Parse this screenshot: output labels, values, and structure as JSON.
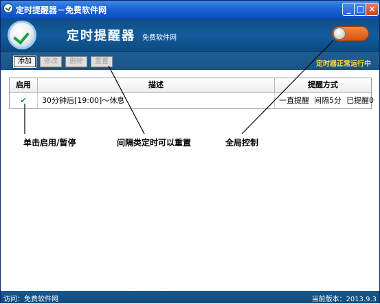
{
  "window": {
    "title": "定时提醒器－免费软件网"
  },
  "header": {
    "app_title": "定时提醒器",
    "subtitle": "免费软件网",
    "global_switch_on": true
  },
  "toolbar": {
    "buttons": [
      {
        "label": "添加",
        "enabled": true
      },
      {
        "label": "修改",
        "enabled": false
      },
      {
        "label": "删除",
        "enabled": false
      },
      {
        "label": "重置",
        "enabled": false
      }
    ],
    "status_text": "定时器正常运行中"
  },
  "table": {
    "columns": [
      "启用",
      "描述",
      "提醒方式"
    ],
    "rows": [
      {
        "enabled": true,
        "enabled_mark": "✔",
        "description": "30分钟后[19:00]～休息",
        "method": "一直提醒  间隔5分  已提醒0"
      }
    ]
  },
  "annotations": {
    "toggle_enable": "单击启用/暂停",
    "reset_interval": "间隔类定时可以重置",
    "global_control": "全局控制"
  },
  "footer": {
    "visit": "访问：免费软件网",
    "version": "当前版本：2013.9.3"
  },
  "colors": {
    "header_bg": "#125c9b",
    "accent_orange": "#d35412",
    "status_yellow": "#ffd640",
    "check_green": "#1f8e33"
  }
}
